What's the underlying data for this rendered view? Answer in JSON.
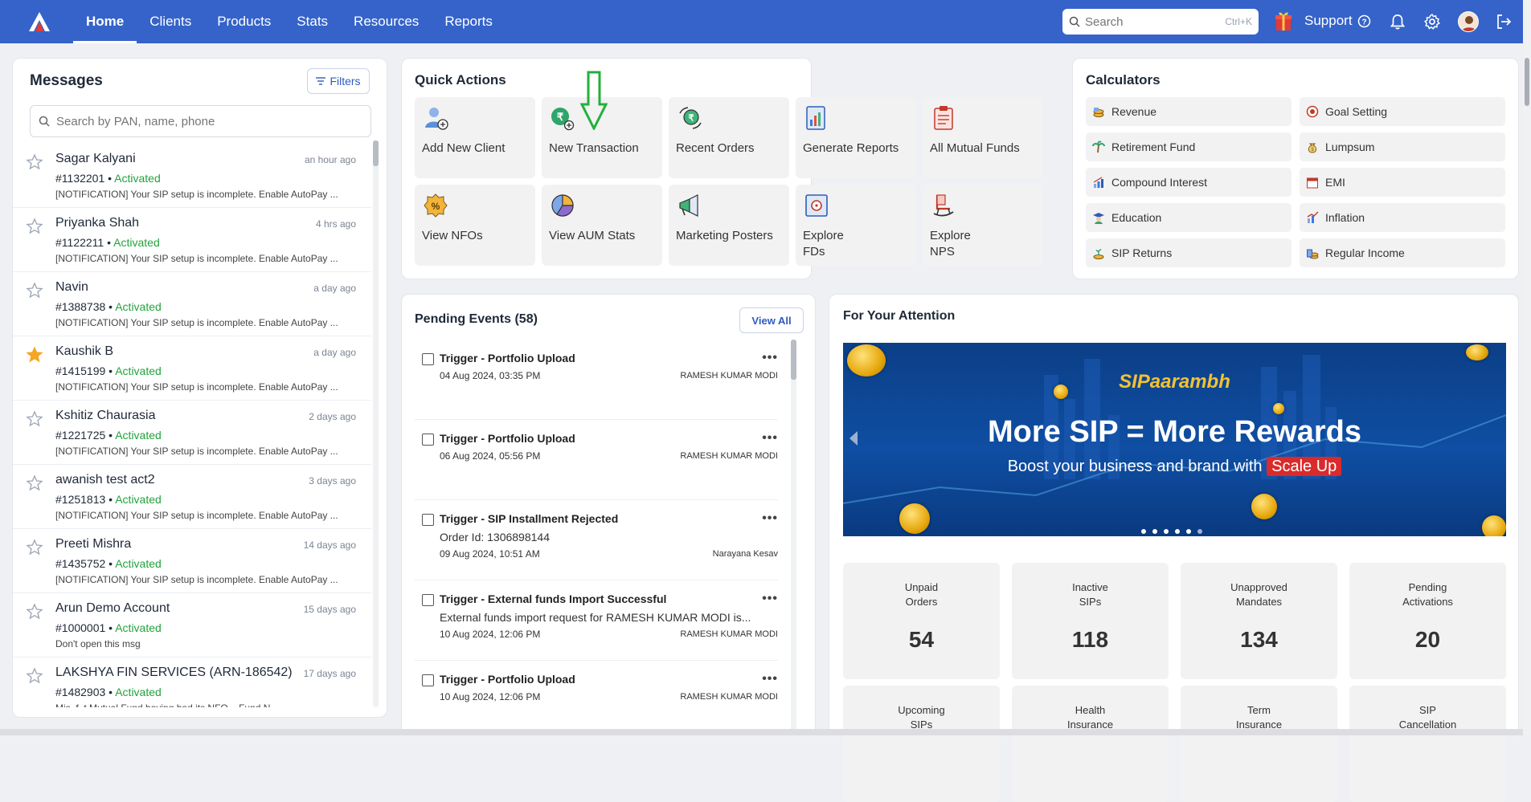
{
  "nav": {
    "links": [
      "Home",
      "Clients",
      "Products",
      "Stats",
      "Resources",
      "Reports"
    ],
    "active": "Home",
    "search_placeholder": "Search",
    "search_shortcut": "Ctrl+K",
    "support_label": "Support"
  },
  "messages": {
    "title": "Messages",
    "filters_label": "Filters",
    "search_placeholder": "Search by PAN, name, phone",
    "items": [
      {
        "name": "Sagar Kalyani",
        "time": "an hour ago",
        "id": "#1132201",
        "status": "Activated",
        "preview": "[NOTIFICATION] Your SIP setup is incomplete. Enable AutoPay ...",
        "starred": false
      },
      {
        "name": "Priyanka Shah",
        "time": "4 hrs ago",
        "id": "#1122211",
        "status": "Activated",
        "preview": "[NOTIFICATION] Your SIP setup is incomplete. Enable AutoPay ...",
        "starred": false
      },
      {
        "name": "Navin",
        "time": "a day ago",
        "id": "#1388738",
        "status": "Activated",
        "preview": "[NOTIFICATION] Your SIP setup is incomplete. Enable AutoPay ...",
        "starred": false
      },
      {
        "name": "Kaushik B",
        "time": "a day ago",
        "id": "#1415199",
        "status": "Activated",
        "preview": "[NOTIFICATION] Your SIP setup is incomplete. Enable AutoPay ...",
        "starred": true
      },
      {
        "name": "Kshitiz Chaurasia",
        "time": "2 days ago",
        "id": "#1221725",
        "status": "Activated",
        "preview": "[NOTIFICATION] Your SIP setup is incomplete. Enable AutoPay ...",
        "starred": false
      },
      {
        "name": "awanish test act2",
        "time": "3 days ago",
        "id": "#1251813",
        "status": "Activated",
        "preview": "[NOTIFICATION] Your SIP setup is incomplete. Enable AutoPay ...",
        "starred": false
      },
      {
        "name": "Preeti Mishra",
        "time": "14 days ago",
        "id": "#1435752",
        "status": "Activated",
        "preview": "[NOTIFICATION] Your SIP setup is incomplete. Enable AutoPay ...",
        "starred": false
      },
      {
        "name": "Arun Demo Account",
        "time": "15 days ago",
        "id": "#1000001",
        "status": "Activated",
        "preview": "Don't open this msg",
        "starred": false
      },
      {
        "name": "LAKSHYA FIN SERVICES (ARN-186542)",
        "time": "17 days ago",
        "id": "#1482903",
        "status": "Activated",
        "preview": "Mis..f..t Mutual Fund having had its NFO... Fund N...",
        "starred": false
      }
    ]
  },
  "quick_actions": {
    "title": "Quick Actions",
    "items": [
      {
        "label": "Add New Client",
        "icon": "add-client-icon"
      },
      {
        "label": "New Transaction",
        "icon": "new-transaction-icon"
      },
      {
        "label": "Recent Orders",
        "icon": "recent-orders-icon"
      },
      {
        "label": "Generate Reports",
        "icon": "reports-icon"
      },
      {
        "label": "All Mutual Funds",
        "icon": "mutual-funds-icon"
      },
      {
        "label": "View NFOs",
        "icon": "nfo-icon"
      },
      {
        "label": "View AUM Stats",
        "icon": "pie-chart-icon"
      },
      {
        "label": "Marketing Posters",
        "icon": "megaphone-icon"
      },
      {
        "label": "Explore\nFDs",
        "icon": "safe-icon"
      },
      {
        "label": "Explore\nNPS",
        "icon": "rocking-chair-icon"
      }
    ]
  },
  "calculators": {
    "title": "Calculators",
    "items": [
      {
        "label": "Revenue",
        "icon": "coins-icon"
      },
      {
        "label": "Goal Setting",
        "icon": "target-icon"
      },
      {
        "label": "Retirement Fund",
        "icon": "palm-tree-icon"
      },
      {
        "label": "Lumpsum",
        "icon": "money-bag-icon"
      },
      {
        "label": "Compound Interest",
        "icon": "bar-growth-icon"
      },
      {
        "label": "EMI",
        "icon": "calendar-icon"
      },
      {
        "label": "Education",
        "icon": "graduate-icon"
      },
      {
        "label": "Inflation",
        "icon": "trend-up-icon"
      },
      {
        "label": "SIP Returns",
        "icon": "plant-coins-icon"
      },
      {
        "label": "Regular Income",
        "icon": "coin-stack-icon"
      }
    ]
  },
  "pending": {
    "title": "Pending Events (58)",
    "view_all": "View All",
    "items": [
      {
        "title": "Trigger - Portfolio Upload",
        "desc": "",
        "date": "04 Aug 2024, 03:35 PM",
        "owner": "RAMESH KUMAR MODI"
      },
      {
        "title": "Trigger - Portfolio Upload",
        "desc": "",
        "date": "06 Aug 2024, 05:56 PM",
        "owner": "RAMESH KUMAR MODI"
      },
      {
        "title": "Trigger - SIP Installment Rejected",
        "desc": "Order Id: 1306898144",
        "date": "09 Aug 2024, 10:51 AM",
        "owner": "Narayana Kesav"
      },
      {
        "title": "Trigger - External funds Import Successful",
        "desc": "External funds import request for RAMESH KUMAR MODI is...",
        "date": "10 Aug 2024, 12:06 PM",
        "owner": "RAMESH KUMAR MODI"
      },
      {
        "title": "Trigger - Portfolio Upload",
        "desc": "",
        "date": "10 Aug 2024, 12:06 PM",
        "owner": "RAMESH KUMAR MODI"
      }
    ]
  },
  "attention": {
    "title": "For Your Attention",
    "banner": {
      "brand": "SIPaarambh",
      "headline": "More SIP = More Rewards",
      "sub_prefix": "Boost your business and brand with",
      "sub_highlight": "Scale Up"
    },
    "stats": [
      {
        "label": "Unpaid\nOrders",
        "value": "54"
      },
      {
        "label": "Inactive\nSIPs",
        "value": "118"
      },
      {
        "label": "Unapproved\nMandates",
        "value": "134"
      },
      {
        "label": "Pending\nActivations",
        "value": "20"
      },
      {
        "label": "Upcoming\nSIPs",
        "value": ""
      },
      {
        "label": "Health\nInsurance",
        "value": ""
      },
      {
        "label": "Term\nInsurance",
        "value": ""
      },
      {
        "label": "SIP\nCancellation",
        "value": ""
      }
    ]
  },
  "colors": {
    "primary": "#3563c9",
    "activated": "#22a33b",
    "star_active": "#f5a623"
  }
}
